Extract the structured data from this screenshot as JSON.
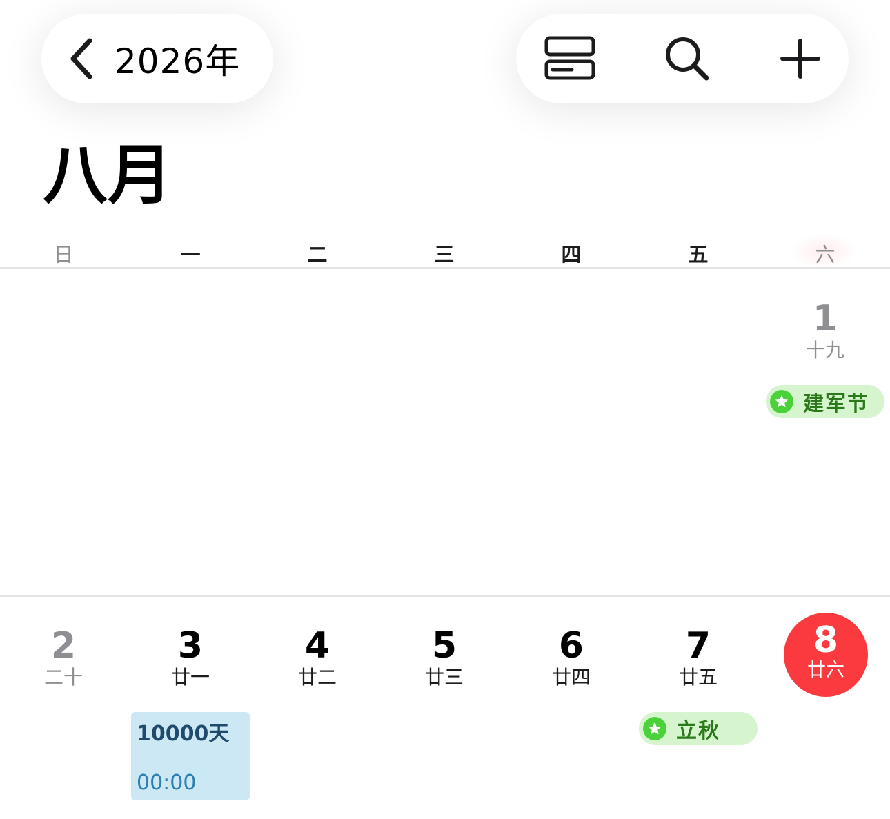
{
  "header": {
    "back_label": "2026年",
    "actions": [
      {
        "name": "list-view",
        "icon": "list-view-icon"
      },
      {
        "name": "search",
        "icon": "search-icon"
      },
      {
        "name": "add",
        "icon": "plus-icon"
      }
    ]
  },
  "month_title": "八月",
  "weekdays": [
    "日",
    "一",
    "二",
    "三",
    "四",
    "五",
    "六"
  ],
  "weeks": [
    {
      "days": [
        {
          "day": "1",
          "lunar": "十九",
          "weekday": "六",
          "muted": true
        }
      ]
    },
    {
      "days": [
        {
          "day": "2",
          "lunar": "二十",
          "weekday": "日",
          "muted": true
        },
        {
          "day": "3",
          "lunar": "廿一",
          "weekday": "一"
        },
        {
          "day": "4",
          "lunar": "廿二",
          "weekday": "二"
        },
        {
          "day": "5",
          "lunar": "廿三",
          "weekday": "三"
        },
        {
          "day": "6",
          "lunar": "廿四",
          "weekday": "四"
        },
        {
          "day": "7",
          "lunar": "廿五",
          "weekday": "五"
        },
        {
          "day": "8",
          "lunar": "廿六",
          "weekday": "六",
          "today": true
        }
      ]
    }
  ],
  "holidays": [
    {
      "name": "建军节",
      "date": "1",
      "icon": "star-icon"
    },
    {
      "name": "立秋",
      "date": "7",
      "icon": "star-icon"
    }
  ],
  "events": [
    {
      "title": "10000天",
      "time": "00:00",
      "date": "3"
    }
  ],
  "colors": {
    "today": "#fb3a3f",
    "holiday_bg": "#d6f5cf",
    "holiday_icon": "#4bd23b",
    "holiday_text": "#2a7a19",
    "event_bg": "#cde8f5",
    "event_title": "#1f4a6b",
    "event_time": "#2d7fb0",
    "muted_text": "#8e8e93"
  }
}
